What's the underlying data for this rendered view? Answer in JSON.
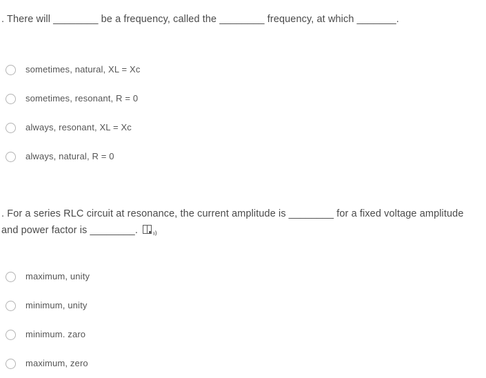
{
  "page": {
    "background_color": "#ffffff",
    "text_color": "#4a4a4a",
    "option_text_color": "#555555",
    "radio_border_color": "#b3b3b3"
  },
  "questions": [
    {
      "id": "q1",
      "text": ". There will ________ be a frequency, called the ________ frequency, at which _______.",
      "has_readaloud": false,
      "options": [
        {
          "label": "sometimes, natural, XL = Xc",
          "selected": false
        },
        {
          "label": "sometimes, resonant, R = 0",
          "selected": false
        },
        {
          "label": "always, resonant, XL = Xc",
          "selected": false
        },
        {
          "label": "always, natural, R = 0",
          "selected": false
        }
      ]
    },
    {
      "id": "q2",
      "text": ". For a series RLC circuit at resonance, the current amplitude is ________ for a fixed voltage amplitude and power factor is ________.",
      "has_readaloud": true,
      "readaloud_icon": "read-aloud-icon",
      "options": [
        {
          "label": "maximum, unity",
          "selected": false
        },
        {
          "label": "minimum, unity",
          "selected": false
        },
        {
          "label": "minimum. zaro",
          "selected": false
        },
        {
          "label": "maximum, zero",
          "selected": false
        }
      ]
    }
  ]
}
